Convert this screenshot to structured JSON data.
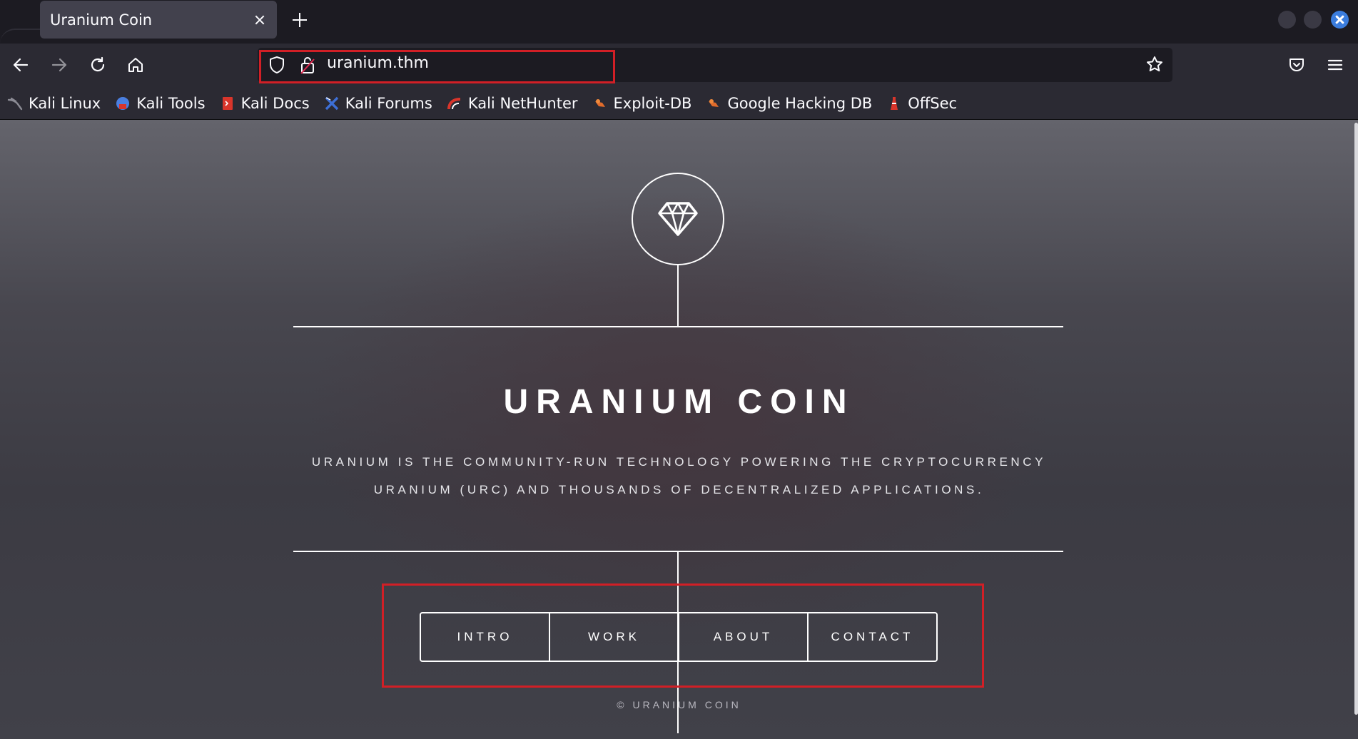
{
  "tab": {
    "title": "Uranium Coin"
  },
  "address_bar": {
    "url": "uranium.thm"
  },
  "bookmarks": [
    {
      "label": "Kali Linux",
      "icon": "kali-dragon-icon",
      "color": "#8b8b94"
    },
    {
      "label": "Kali Tools",
      "icon": "kali-tools-icon",
      "color": "#4a7fe0"
    },
    {
      "label": "Kali Docs",
      "icon": "kali-docs-icon",
      "color": "#d9352b"
    },
    {
      "label": "Kali Forums",
      "icon": "kali-forums-icon",
      "color": "#3d6fd6"
    },
    {
      "label": "Kali NetHunter",
      "icon": "kali-nethunter-icon",
      "color": "#d9352b"
    },
    {
      "label": "Exploit-DB",
      "icon": "exploit-db-icon",
      "color": "#e06b2b"
    },
    {
      "label": "Google Hacking DB",
      "icon": "google-hacking-db-icon",
      "color": "#e06b2b"
    },
    {
      "label": "OffSec",
      "icon": "offsec-icon",
      "color": "#d9352b"
    }
  ],
  "site": {
    "title": "URANIUM COIN",
    "tagline_line1": "URANIUM IS THE COMMUNITY-RUN TECHNOLOGY POWERING THE CRYPTOCURRENCY",
    "tagline_line2": "URANIUM (URC) AND THOUSANDS OF DECENTRALIZED APPLICATIONS.",
    "nav": [
      "INTRO",
      "WORK",
      "ABOUT",
      "CONTACT"
    ],
    "footer": "© URANIUM COIN",
    "logo_icon": "diamond-icon"
  },
  "colors": {
    "highlight": "#d11f26",
    "chrome_dark": "#1c1b22",
    "chrome_toolbar": "#2b2a33",
    "close_button": "#3b7ddd"
  }
}
